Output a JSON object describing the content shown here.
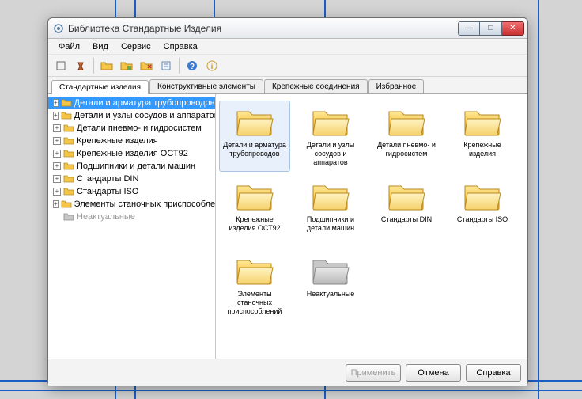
{
  "window": {
    "title": "Библиотека Стандартные Изделия"
  },
  "menu": {
    "file": "Файл",
    "view": "Вид",
    "service": "Сервис",
    "help": "Справка"
  },
  "toolbar": {
    "icons": [
      "nav",
      "grid",
      "folder1",
      "folder2",
      "folder3",
      "prop",
      "help",
      "info"
    ]
  },
  "tabs": {
    "items": [
      {
        "label": "Стандартные изделия",
        "active": true
      },
      {
        "label": "Конструктивные элементы",
        "active": false
      },
      {
        "label": "Крепежные соединения",
        "active": false
      },
      {
        "label": "Избранное",
        "active": false
      }
    ]
  },
  "tree": {
    "items": [
      {
        "label": "Детали и арматура трубопроводов",
        "selected": true
      },
      {
        "label": "Детали и узлы сосудов и аппаратов"
      },
      {
        "label": "Детали пневмо- и гидросистем"
      },
      {
        "label": "Крепежные изделия"
      },
      {
        "label": "Крепежные изделия ОСТ92"
      },
      {
        "label": "Подшипники и детали машин"
      },
      {
        "label": "Стандарты DIN"
      },
      {
        "label": "Стандарты ISO"
      },
      {
        "label": "Элементы станочных приспособлений"
      },
      {
        "label": "Неактуальные",
        "disabled": true
      }
    ]
  },
  "folders": {
    "items": [
      {
        "label": "Детали и арматура трубопроводов",
        "selected": true
      },
      {
        "label": "Детали и узлы сосудов и аппаратов"
      },
      {
        "label": "Детали пневмо- и гидросистем"
      },
      {
        "label": "Крепежные изделия"
      },
      {
        "label": "Крепежные изделия ОСТ92"
      },
      {
        "label": "Подшипники и детали машин"
      },
      {
        "label": "Стандарты DIN"
      },
      {
        "label": "Стандарты ISO"
      },
      {
        "label": "Элементы станочных приспособлений"
      },
      {
        "label": "Неактуальные",
        "disabled": true
      }
    ]
  },
  "footer": {
    "apply": "Применить",
    "cancel": "Отмена",
    "help": "Справка"
  }
}
